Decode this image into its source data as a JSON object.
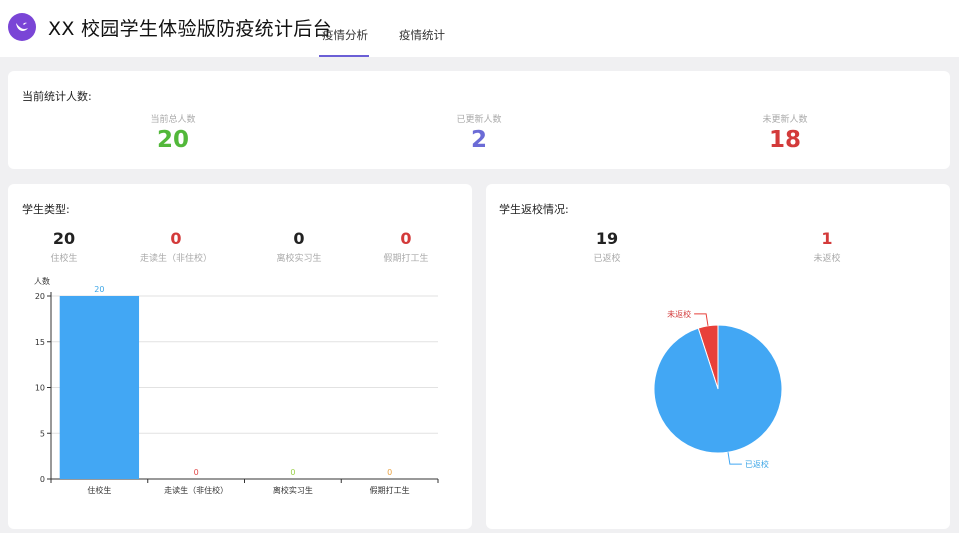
{
  "header": {
    "title": "XX 校园学生体验版防疫统计后台",
    "tabs": [
      {
        "label": "疫情分析",
        "active": true
      },
      {
        "label": "疫情统计",
        "active": false
      }
    ],
    "accent": "#6b5fd6",
    "logo_color": "#7a45d6"
  },
  "summary": {
    "title": "当前统计人数:",
    "stats": [
      {
        "label": "当前总人数",
        "value": "20",
        "color": "#52b83a"
      },
      {
        "label": "已更新人数",
        "value": "2",
        "color": "#6b6bd6"
      },
      {
        "label": "未更新人数",
        "value": "18",
        "color": "#d33a3a"
      }
    ]
  },
  "student_types": {
    "title": "学生类型:",
    "stats": [
      {
        "label": "住校生",
        "value": "20",
        "color": "#222222"
      },
      {
        "label": "走读生（非住校）",
        "value": "0",
        "color": "#d33a3a"
      },
      {
        "label": "离校实习生",
        "value": "0",
        "color": "#222222"
      },
      {
        "label": "假期打工生",
        "value": "0",
        "color": "#d33a3a"
      }
    ]
  },
  "return_status": {
    "title": "学生返校情况:",
    "stats": [
      {
        "label": "已返校",
        "value": "19",
        "color": "#222222"
      },
      {
        "label": "未返校",
        "value": "1",
        "color": "#d33a3a"
      }
    ]
  },
  "chart_data": [
    {
      "type": "bar",
      "ylabel": "人数",
      "categories": [
        "住校生",
        "走读生（非住校）",
        "离校实习生",
        "假期打工生"
      ],
      "values": [
        20,
        0,
        0,
        0
      ],
      "label_colors": [
        "#3ba5e6",
        "#e04a4a",
        "#9ad04a",
        "#e8a040"
      ],
      "bar_color": "#42a7f4",
      "ylim": [
        0,
        20
      ],
      "yticks": [
        0,
        5,
        10,
        15,
        20
      ],
      "grid": true
    },
    {
      "type": "pie",
      "labels": [
        "已返校",
        "未返校"
      ],
      "values": [
        19,
        1
      ],
      "colors": [
        "#42a7f4",
        "#e8403a"
      ],
      "label_colors": [
        "#3ba5e6",
        "#d33a3a"
      ]
    }
  ]
}
